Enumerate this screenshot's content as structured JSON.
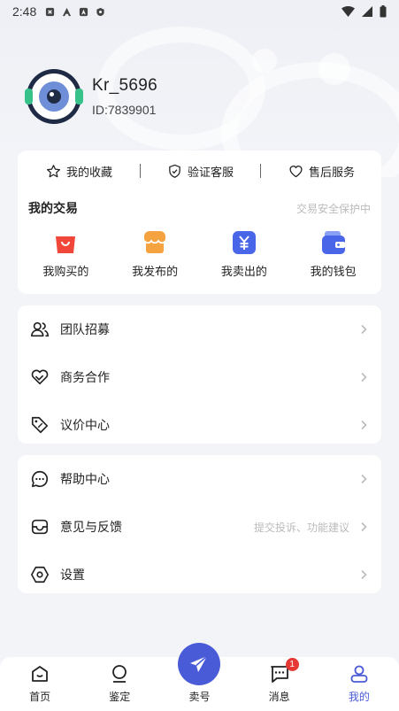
{
  "status_bar": {
    "time": "2:48"
  },
  "profile": {
    "name": "Kr_5696",
    "id_text": "ID:7839901"
  },
  "quick_links": [
    {
      "label": "我的收藏",
      "icon": "star-icon"
    },
    {
      "label": "验证客服",
      "icon": "shield-check-icon"
    },
    {
      "label": "售后服务",
      "icon": "heart-icon"
    }
  ],
  "trade": {
    "title": "我的交易",
    "note": "交易安全保护中",
    "items": [
      {
        "label": "我购买的",
        "icon": "shopping-bag-icon",
        "color": "#f0473a"
      },
      {
        "label": "我发布的",
        "icon": "shop-icon",
        "color": "#f5a340"
      },
      {
        "label": "我卖出的",
        "icon": "yuan-icon",
        "color": "#4a66e8"
      },
      {
        "label": "我的钱包",
        "icon": "wallet-icon",
        "color": "#4a66e8"
      }
    ]
  },
  "menu_group_1": [
    {
      "label": "团队招募",
      "icon": "team-icon"
    },
    {
      "label": "商务合作",
      "icon": "handshake-icon"
    },
    {
      "label": "议价中心",
      "icon": "price-tag-icon"
    }
  ],
  "menu_group_2": [
    {
      "label": "帮助中心",
      "icon": "chat-help-icon",
      "hint": ""
    },
    {
      "label": "意见与反馈",
      "icon": "inbox-icon",
      "hint": "提交投诉、功能建议"
    },
    {
      "label": "设置",
      "icon": "settings-hex-icon",
      "hint": ""
    }
  ],
  "bottom_nav": {
    "items": [
      {
        "label": "首页",
        "icon": "home-icon"
      },
      {
        "label": "鉴定",
        "icon": "appraise-icon"
      },
      {
        "label": "卖号",
        "icon": "send-icon"
      },
      {
        "label": "消息",
        "icon": "message-icon",
        "badge": "1"
      },
      {
        "label": "我的",
        "icon": "profile-icon"
      }
    ],
    "active_index": 4,
    "accent_color": "#4a5bd8"
  }
}
